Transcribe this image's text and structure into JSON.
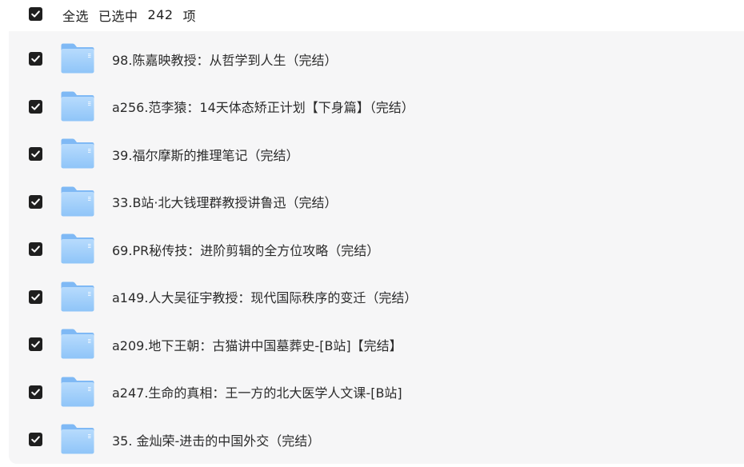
{
  "header": {
    "select_all_label": "全选",
    "selected_prefix": "已选中",
    "selected_count": "242",
    "selected_suffix": "项"
  },
  "items": [
    {
      "name": "98.陈嘉映教授：从哲学到人生（完结）",
      "checked": true,
      "icon": "folder-icon"
    },
    {
      "name": "a256.范李猿：14天体态矫正计划【下身篇】（完结）",
      "checked": true,
      "icon": "folder-icon"
    },
    {
      "name": "39.福尔摩斯的推理笔记（完结）",
      "checked": true,
      "icon": "folder-icon"
    },
    {
      "name": "33.B站·北大钱理群教授讲鲁迅（完结）",
      "checked": true,
      "icon": "folder-icon"
    },
    {
      "name": "69.PR秘传技：进阶剪辑的全方位攻略（完结）",
      "checked": true,
      "icon": "folder-icon"
    },
    {
      "name": "a149.人大吴征宇教授：现代国际秩序的变迁（完结）",
      "checked": true,
      "icon": "folder-icon"
    },
    {
      "name": "a209.地下王朝：古猫讲中国墓葬史-[B站]【完结】",
      "checked": true,
      "icon": "folder-icon"
    },
    {
      "name": "a247.生命的真相：王一方的北大医学人文课-[B站]",
      "checked": true,
      "icon": "folder-icon"
    },
    {
      "name": "35. 金灿荣-进击的中国外交（完结）",
      "checked": true,
      "icon": "folder-icon"
    }
  ],
  "colors": {
    "checkbox": "#1f1f1f",
    "folder_light": "#a9d3fb",
    "folder_dark": "#6fb0f3",
    "panel_bg": "#f6f6f7"
  }
}
